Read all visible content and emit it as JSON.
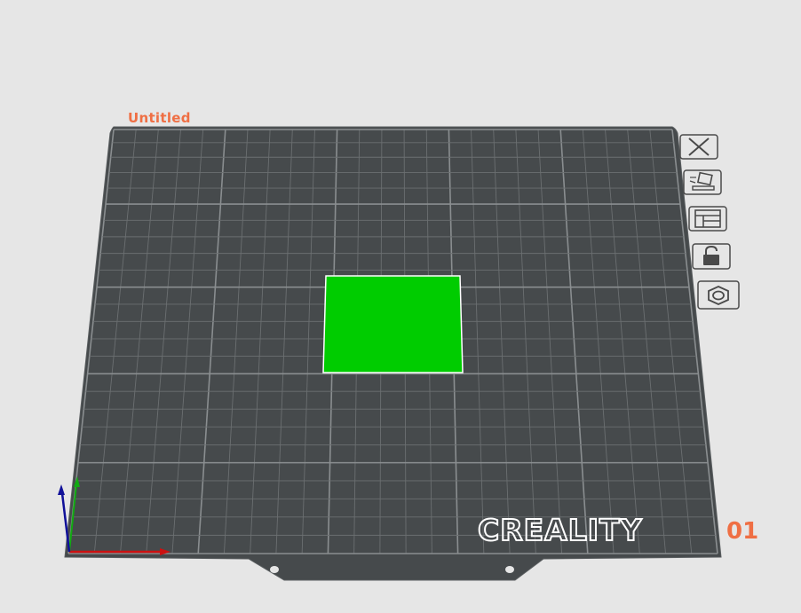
{
  "plate": {
    "title": "Untitled",
    "number": "01",
    "brand": "CREALITY"
  },
  "colors": {
    "background": "#e6e6e6",
    "bed": "#464a4c",
    "grid_major": "#8a8e90",
    "grid_minor": "#6b6f71",
    "accent": "#ef6f44",
    "object": "#00cc00",
    "axis_x": "#cc1111",
    "axis_y": "#11aa11",
    "axis_z": "#111199"
  },
  "toolbar": {
    "buttons": [
      {
        "name": "delete-plate-button",
        "icon": "close-icon"
      },
      {
        "name": "auto-orient-button",
        "icon": "auto-orient-icon"
      },
      {
        "name": "arrange-button",
        "icon": "arrange-layout-icon"
      },
      {
        "name": "lock-plate-button",
        "icon": "lock-icon"
      },
      {
        "name": "plate-settings-button",
        "icon": "hexagon-nut-icon"
      }
    ]
  },
  "objects": [
    {
      "name": "model-object",
      "color": "#00cc00",
      "selected": true
    }
  ]
}
